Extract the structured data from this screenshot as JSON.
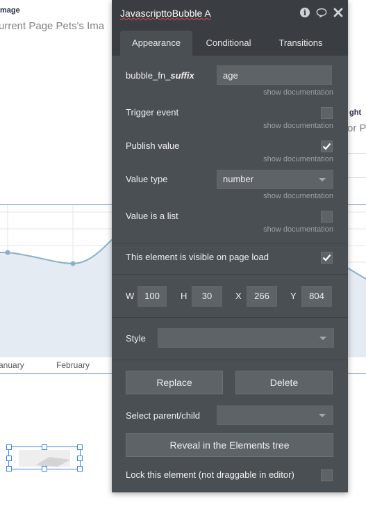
{
  "background": {
    "image_label": "mage",
    "image_title": "urrent Page Pets's Ima",
    "right_label": "ght",
    "right_title": "or Pe",
    "chart_data": {
      "type": "area",
      "categories": [
        "anuary",
        "February"
      ],
      "x_tick_labels": [
        "anuary",
        "February"
      ],
      "grid": true,
      "color": "#8ab0c8",
      "fill": "#e4ebf2"
    }
  },
  "panel": {
    "title": "JavascripttoBubble A",
    "icons": [
      "info-icon",
      "comment-icon",
      "close-icon"
    ],
    "tabs": [
      {
        "label": "Appearance",
        "active": true
      },
      {
        "label": "Conditional",
        "active": false
      },
      {
        "label": "Transitions",
        "active": false
      }
    ],
    "suffix_label_prefix": "bubble_fn_",
    "suffix_label_em": "suffix",
    "suffix_value": "age",
    "doc_link": "show documentation",
    "trigger_event_label": "Trigger event",
    "trigger_event_checked": false,
    "publish_value_label": "Publish value",
    "publish_value_checked": true,
    "value_type_label": "Value type",
    "value_type_value": "number",
    "value_is_list_label": "Value is a list",
    "value_is_list_checked": false,
    "visible_label": "This element is visible on page load",
    "visible_checked": true,
    "w_label": "W",
    "w_value": "100",
    "h_label": "H",
    "h_value": "30",
    "x_label": "X",
    "x_value": "266",
    "y_label": "Y",
    "y_value": "804",
    "style_label": "Style",
    "style_value": "",
    "replace_label": "Replace",
    "delete_label": "Delete",
    "parent_child_label": "Select parent/child",
    "parent_child_value": "",
    "reveal_label": "Reveal in the Elements tree",
    "lock_label": "Lock this element (not draggable in editor)",
    "lock_checked": false
  }
}
